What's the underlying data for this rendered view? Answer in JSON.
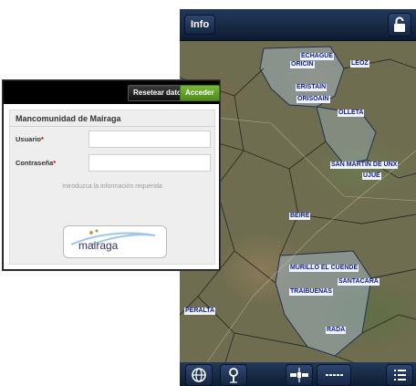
{
  "app": {
    "info_label": "Info",
    "lock_icon": "lock-icon"
  },
  "map": {
    "towns": [
      "ECHAGUE",
      "ORICIN",
      "LEOZ",
      "ERISTAIN",
      "ORISOAIN",
      "OLLETA",
      "SAN MARTIN DE UNX",
      "UJUE",
      "BEIRE",
      "MURILLO EL CUENDE",
      "SANTACARA",
      "TRAIBUENAS",
      "PERALTA",
      "RADA"
    ]
  },
  "bottom_bar": {
    "icons": [
      "globe-icon",
      "location-pin-icon",
      "satellite-icon",
      "ruler-icon",
      "list-icon"
    ]
  },
  "login": {
    "reset_label": "Resetear datos",
    "submit_label": "Acceder",
    "title": "Mancomunidad de Mairaga",
    "user_label": "Usuario",
    "password_label": "Contraseña",
    "required_mark": "*",
    "user_value": "",
    "password_value": "",
    "hint": "Introduzca la información requerida",
    "logo_text": "mairaga"
  },
  "colors": {
    "town_text": "#0f1b8c",
    "accent_green": "#6aa62f",
    "topbar": "#1b2e4c"
  }
}
